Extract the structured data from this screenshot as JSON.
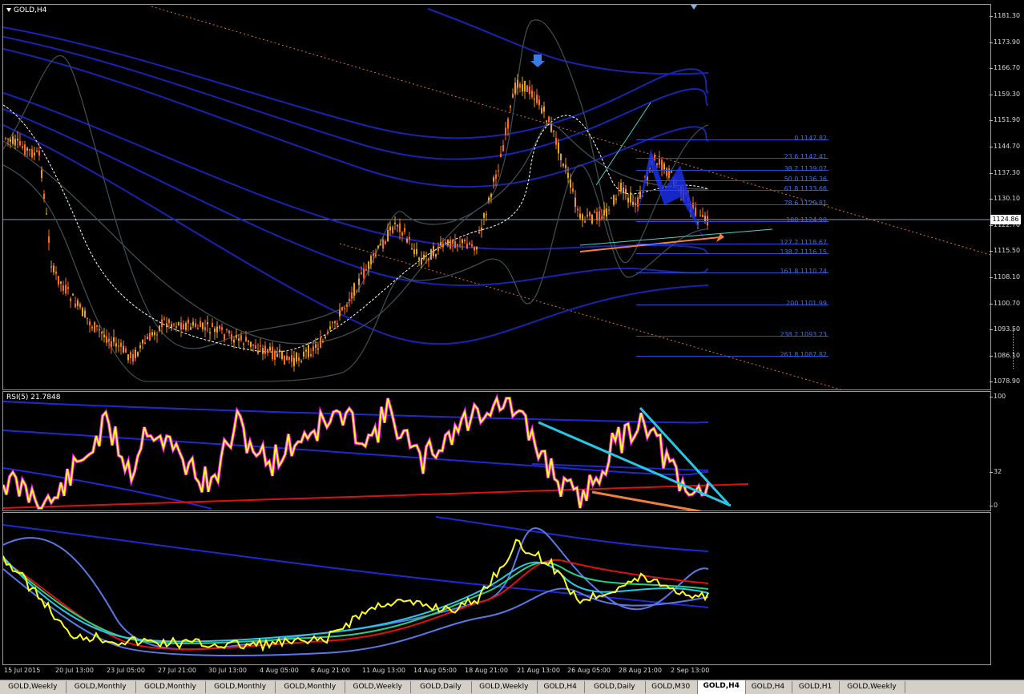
{
  "main_title": "GOLD,H4",
  "rsi_title": "RSI(5) 21.7848",
  "current_price": "1124.86",
  "price_ticks": [
    "1181.30",
    "1173.90",
    "1166.70",
    "1159.30",
    "1151.90",
    "1144.70",
    "1137.30",
    "1130.10",
    "1122.70",
    "1115.50",
    "1108.10",
    "1100.70",
    "1093.50",
    "1086.10",
    "1078.90"
  ],
  "rsi_ticks": [
    "100",
    "32",
    "0"
  ],
  "fib_levels": [
    {
      "label": "0 1147.82"
    },
    {
      "label": "23.6 1142.41"
    },
    {
      "label": "38.2 1139.07"
    },
    {
      "label": "50.0 1136.36"
    },
    {
      "label": "61.8 1133.66"
    },
    {
      "label": "78.6 1129.81"
    },
    {
      "label": "100 1124.90"
    },
    {
      "label": "127.2 1118.67"
    },
    {
      "label": "138.2 1116.15"
    },
    {
      "label": "161.8 1110.74"
    },
    {
      "label": "200 1101.99"
    },
    {
      "label": "238.2 1093.23"
    },
    {
      "label": "261.8 1087.82"
    }
  ],
  "time_labels": [
    "15 Jul 2015",
    "20 Jul 13:00",
    "23 Jul 05:00",
    "27 Jul 21:00",
    "30 Jul 13:00",
    "4 Aug 05:00",
    "6 Aug 21:00",
    "11 Aug 13:00",
    "14 Aug 05:00",
    "18 Aug 21:00",
    "21 Aug 13:00",
    "26 Aug 05:00",
    "28 Aug 21:00",
    "2 Sep 13:00"
  ],
  "tabs": [
    "GOLD,Weekly",
    "GOLD,Monthly",
    "GOLD,Monthly",
    "GOLD,Monthly",
    "GOLD,Monthly",
    "GOLD,Weekly",
    "GOLD,Daily",
    "GOLD,Weekly",
    "GOLD,H4",
    "GOLD,Daily",
    "GOLD,M30",
    "GOLD,H4",
    "GOLD,H4",
    "GOLD,H1",
    "GOLD,Weekly"
  ],
  "active_tab_index": 11,
  "colors": {
    "bull": "#e8a020",
    "bear": "#ff6a1a",
    "fib": "#2a4bd0",
    "rsi": "#ffff20",
    "trend_cyan": "#27c8e6",
    "trend_orange": "#f08040",
    "red_line": "#e01010"
  }
}
